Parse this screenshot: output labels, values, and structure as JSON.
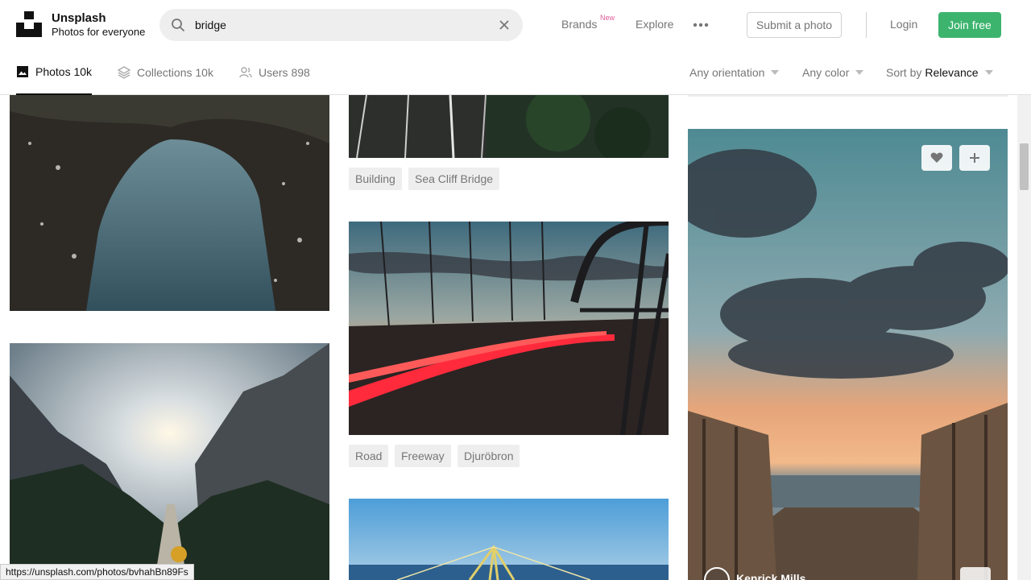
{
  "header": {
    "brand_name": "Unsplash",
    "brand_tagline": "Photos for everyone",
    "search_value": "bridge",
    "nav": {
      "brands": "Brands",
      "new_badge": "New",
      "explore": "Explore"
    },
    "submit_photo": "Submit a photo",
    "login": "Login",
    "join": "Join free",
    "accent": "#3cb46e"
  },
  "tabs": [
    {
      "label": "Photos",
      "count": "10k",
      "icon": "image-icon"
    },
    {
      "label": "Collections",
      "count": "10k",
      "icon": "collections-icon"
    },
    {
      "label": "Users",
      "count": "898",
      "icon": "users-icon"
    }
  ],
  "filters": {
    "orientation": "Any orientation",
    "color": "Any color",
    "sort_prefix": "Sort by",
    "sort_value": "Relevance"
  },
  "columns": {
    "middle": {
      "tags_1": [
        "Building",
        "Sea Cliff Bridge"
      ],
      "tags_2": [
        "Road",
        "Freeway",
        "Djuröbron"
      ]
    },
    "right": {
      "author": "Kenrick Mills"
    }
  },
  "status_url": "https://unsplash.com/photos/bvhahBn89Fs"
}
